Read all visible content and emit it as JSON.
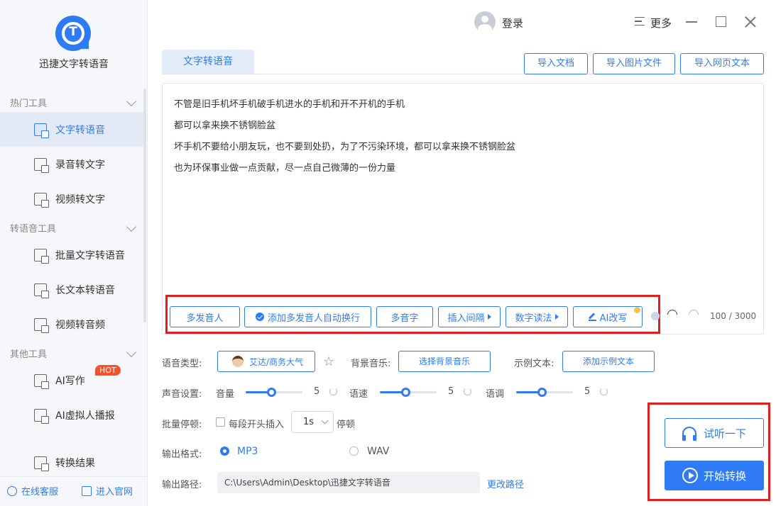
{
  "app": {
    "name": "迅捷文字转语音"
  },
  "header": {
    "login": "登录",
    "more": "更多"
  },
  "sidebar": {
    "groups": [
      {
        "title": "热门工具"
      },
      {
        "title": "转语音工具"
      },
      {
        "title": "其他工具"
      }
    ],
    "items": [
      {
        "label": "文字转语音"
      },
      {
        "label": "录音转文字"
      },
      {
        "label": "视频转文字"
      },
      {
        "label": "批量文字转语音"
      },
      {
        "label": "长文本转语音"
      },
      {
        "label": "视频转音频"
      },
      {
        "label": "AI写作"
      },
      {
        "label": "AI虚拟人播报"
      },
      {
        "label": "转换结果"
      }
    ],
    "hot_badge": "HOT",
    "footer": {
      "service": "在线客服",
      "website": "进入官网"
    }
  },
  "tab": {
    "label": "文字转语音"
  },
  "imports": {
    "doc": "导入文档",
    "image": "导入图片文件",
    "web": "导入网页文本"
  },
  "editor": {
    "lines": [
      "不管是旧手机坏手机破手机进水的手机和开不开机的手机",
      "都可以拿来换不锈钢脸盆",
      "坏手机不要给小朋友玩，也不要到处扔，为了不污染环境，都可以拿来换不锈钢脸盆",
      "也为环保事业做一点贡献，尽一点自己微薄的一份力量"
    ],
    "counter": "100 / 3000"
  },
  "toolbar": {
    "multi_speaker": "多发音人",
    "auto_wrap": "添加多发音人自动换行",
    "polyphone": "多音字",
    "insert_pause": "插入间隔",
    "number_reading": "数字读法",
    "ai_rewrite": "AI改写"
  },
  "settings": {
    "voice_type_label": "语音类型:",
    "voice_name": "艾达/商务大气",
    "bgm_label": "背景音乐:",
    "bgm_button": "选择背景音乐",
    "sample_label": "示例文本:",
    "sample_button": "添加示例文本",
    "sound_label": "声音设置:",
    "volume_label": "音量",
    "volume_value": "5",
    "speed_label": "语速",
    "speed_value": "5",
    "pitch_label": "语调",
    "pitch_value": "5",
    "pause_label": "批量停顿:",
    "pause_text": "每段开头插入",
    "pause_value": "1s",
    "pause_suffix": "停顿",
    "format_label": "输出格式:",
    "format_mp3": "MP3",
    "format_wav": "WAV",
    "path_label": "输出路径:",
    "path_value": "C:\\Users\\Admin\\Desktop\\迅捷文字转语音",
    "change_path": "更改路径"
  },
  "actions": {
    "listen": "试听一下",
    "start": "开始转换"
  },
  "colors": {
    "accent": "#2f7bf5",
    "highlight": "#e02020",
    "hot": "#f5512a"
  }
}
